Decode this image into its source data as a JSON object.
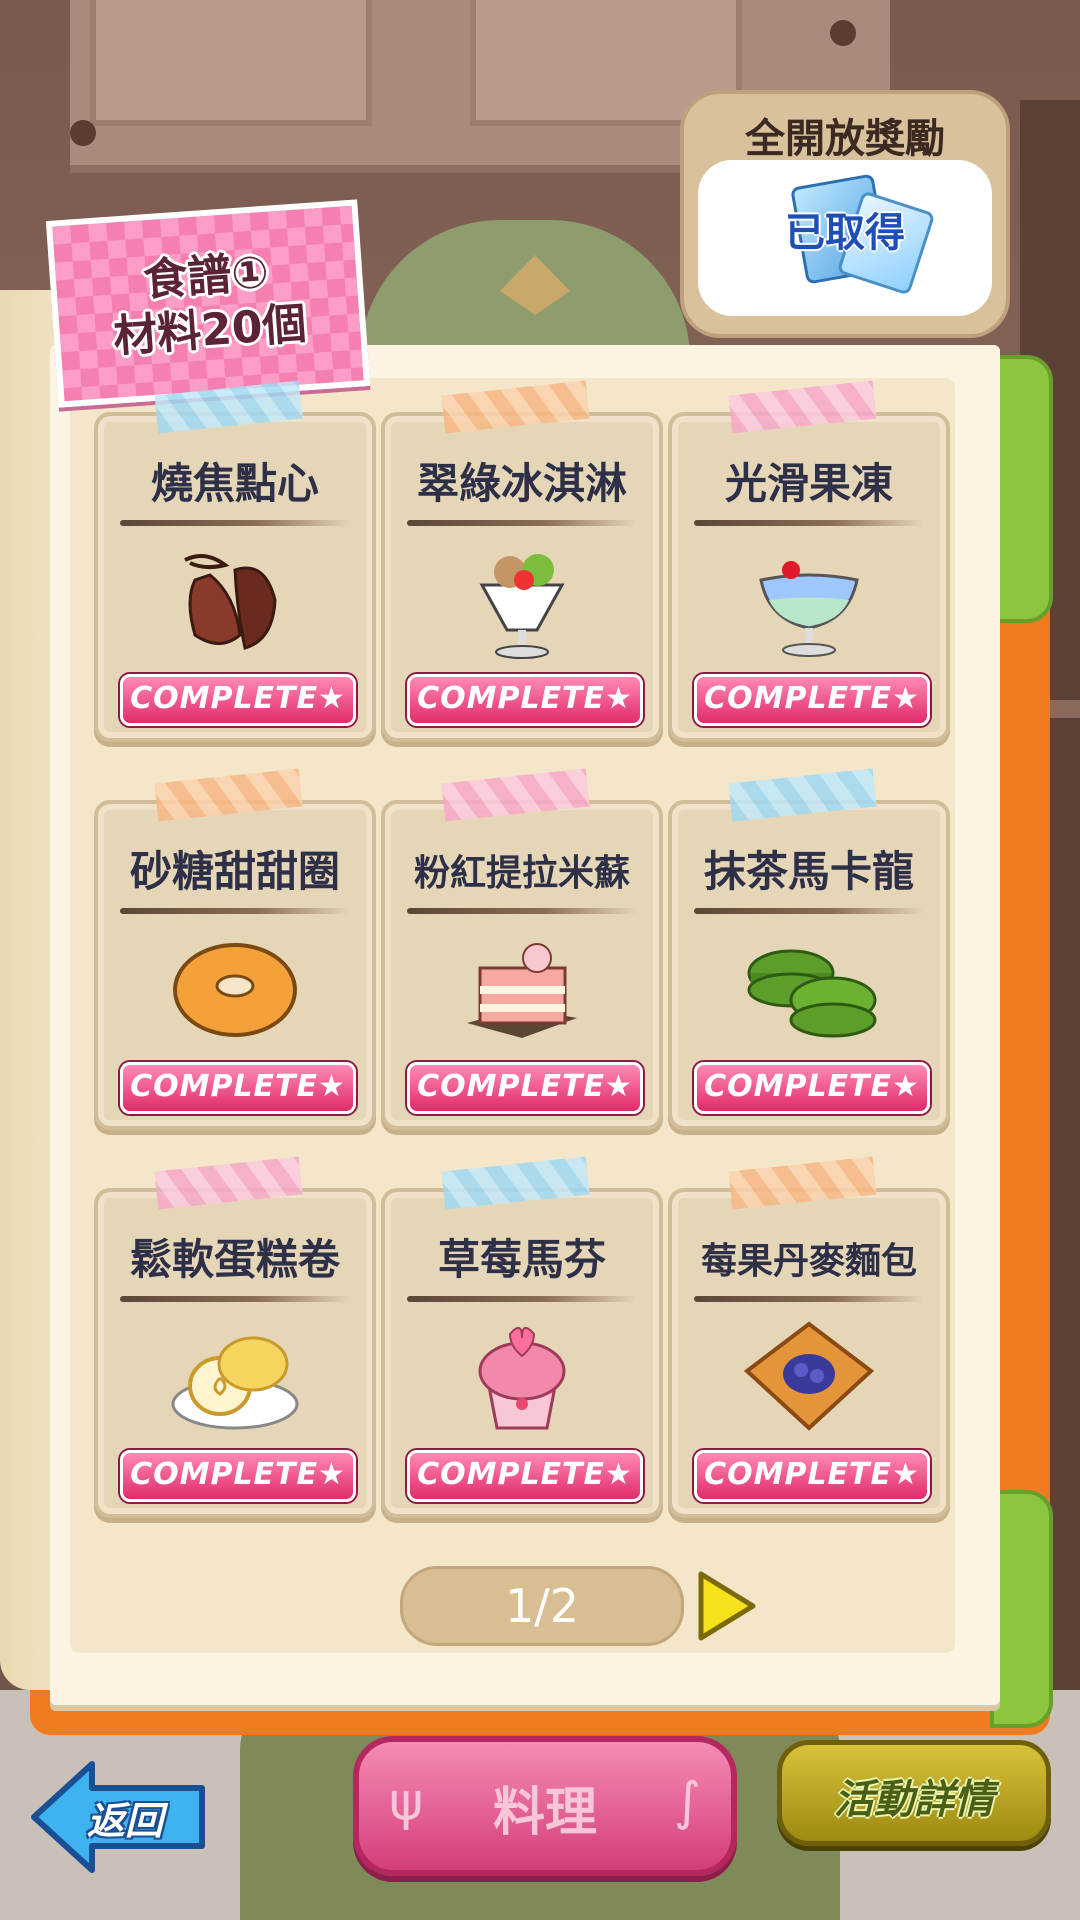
{
  "recipe_label": {
    "line1": "食譜①",
    "line2": "材料20個"
  },
  "reward": {
    "title": "全開放獎勵",
    "status": "已取得"
  },
  "cards": [
    {
      "name": "燒焦點心",
      "badge": "COMPLETE★",
      "tape": "blue",
      "food_icon": "burnt-cookie"
    },
    {
      "name": "翠綠冰淇淋",
      "badge": "COMPLETE★",
      "tape": "orange",
      "food_icon": "parfait"
    },
    {
      "name": "光滑果凍",
      "badge": "COMPLETE★",
      "tape": "pink",
      "food_icon": "jelly"
    },
    {
      "name": "砂糖甜甜圈",
      "badge": "COMPLETE★",
      "tape": "orange",
      "food_icon": "donut"
    },
    {
      "name": "粉紅提拉米蘇",
      "badge": "COMPLETE★",
      "tape": "pink",
      "food_icon": "cake-slice"
    },
    {
      "name": "抹茶馬卡龍",
      "badge": "COMPLETE★",
      "tape": "blue",
      "food_icon": "macaron"
    },
    {
      "name": "鬆軟蛋糕卷",
      "badge": "COMPLETE★",
      "tape": "pink",
      "food_icon": "roll-cake"
    },
    {
      "name": "草莓馬芬",
      "badge": "COMPLETE★",
      "tape": "blue",
      "food_icon": "muffin"
    },
    {
      "name": "莓果丹麥麵包",
      "badge": "COMPLETE★",
      "tape": "orange",
      "food_icon": "danish"
    }
  ],
  "pager": {
    "text": "1/2"
  },
  "buttons": {
    "back": "返回",
    "cook": "料理",
    "event_details": "活動詳情"
  },
  "colors": {
    "complete_badge": "#e02a6c",
    "book_cover": "#f07a1f",
    "book_edge": "#8cc63f"
  }
}
